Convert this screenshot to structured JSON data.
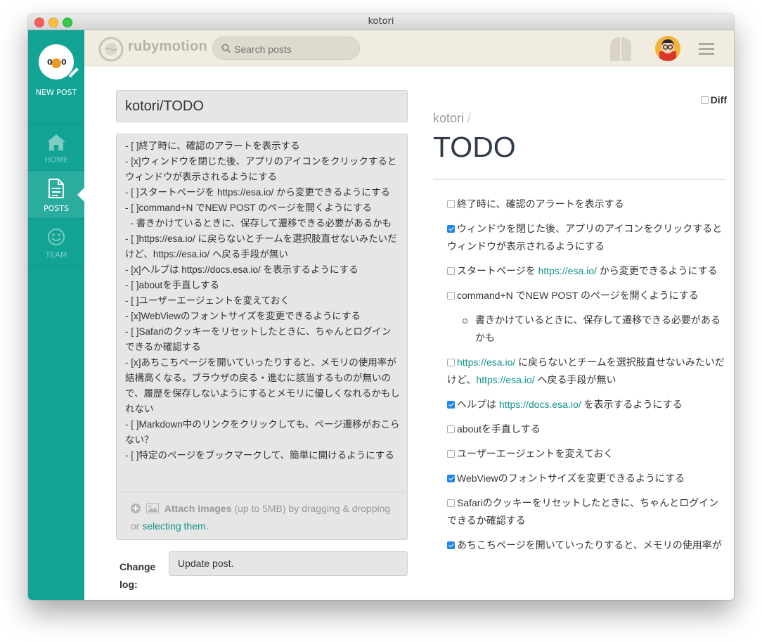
{
  "window": {
    "title": "kotori"
  },
  "sidebar": {
    "items": [
      {
        "label": "NEW POST"
      },
      {
        "label": "HOME"
      },
      {
        "label": "POSTS"
      },
      {
        "label": "TEAM"
      }
    ]
  },
  "topbar": {
    "team_name": "rubymotion",
    "search_placeholder": "Search posts"
  },
  "editor": {
    "title": "kotori/TODO",
    "lines": [
      "- [ ]終了時に、確認のアラートを表示する",
      "- [x]ウィンドウを閉じた後、アプリのアイコンをクリックするとウィンドウが表示されるようにする",
      "- [ ]スタートページを https://esa.io/ から変更できるようにする",
      "- [ ]command+N でNEW POST のページを開くようにする",
      "  - 書きかけているときに、保存して遷移できる必要があるかも",
      "- [ ]https://esa.io/ に戻らないとチームを選択肢直せないみたいだけど、https://esa.io/ へ戻る手段が無い",
      "- [x]ヘルプは https://docs.esa.io/ を表示するようにする",
      "- [ ]aboutを手直しする",
      "- [ ]ユーザーエージェントを変えておく",
      "- [x]WebViewのフォントサイズを変更できるようにする",
      "- [ ]Safariのクッキーをリセットしたときに、ちゃんとログインできるか確認する",
      "- [x]あちこちページを開いていったりすると、メモリの使用率が結構高くなる。ブラウザの戻る・進むに該当するものが無いので、履歴を保存しないようにするとメモリに優しくなれるかもしれない",
      "- [ ]Markdown中のリンクをクリックしても、ページ遷移がおこらない？",
      "- [ ]特定のページをブックマークして、簡単に開けるようにする"
    ],
    "attach_strong": "Attach images",
    "attach_rest": " (up to 5MB) by dragging & dropping",
    "attach_or": "or ",
    "attach_link": "selecting them.",
    "changelog_label": "Change log:",
    "changelog_value": "Update post."
  },
  "preview": {
    "diff_label": "Diff",
    "category": "kotori",
    "title": "TODO",
    "tasks": {
      "t1": "終了時に、確認のアラートを表示する",
      "t2": "ウィンドウを閉じた後、アプリのアイコンをクリックするとウィンドウが表示されるようにする",
      "t3a": "スタートページを ",
      "t3link": "https://esa.io/",
      "t3b": " から変更できるようにする",
      "t4": "command+N でNEW POST のページを開くようにする",
      "t4sub": "書きかけているときに、保存して遷移できる必要があるかも",
      "t5link": "https://esa.io/",
      "t5a": " に戻らないとチームを選択肢直せないみたいだけど、",
      "t5link2": "https://esa.io/",
      "t5b": " へ戻る手段が無い",
      "t6a": "ヘルプは ",
      "t6link": "https://docs.esa.io/",
      "t6b": " を表示するようにする",
      "t7": "aboutを手直しする",
      "t8": "ユーザーエージェントを変えておく",
      "t9": "WebViewのフォントサイズを変更できるようにする",
      "t10": "Safariのクッキーをリセットしたときに、ちゃんとログインできるか確認する",
      "t11": "あちこちページを開いていったりすると、メモリの使用率が"
    }
  },
  "colors": {
    "accent": "#12a394",
    "topbar": "#f0ece0",
    "link": "#12938a"
  }
}
